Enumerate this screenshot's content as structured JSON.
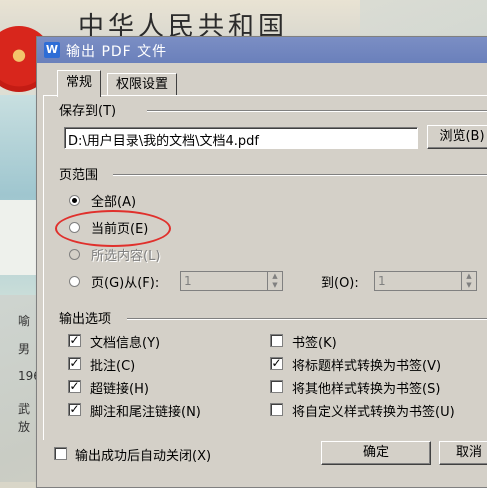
{
  "background": {
    "card_title": "中华人民共和国",
    "rows": [
      "喻",
      "男",
      "196",
      "武",
      "放"
    ]
  },
  "dialog": {
    "app_icon": "W",
    "title": "输出 PDF 文件",
    "tabs": [
      {
        "label": "常规",
        "active": true
      },
      {
        "label": "权限设置",
        "active": false
      }
    ],
    "save": {
      "group_label": "保存到(T)",
      "path_value": "D:\\用户目录\\我的文档\\文档4.pdf",
      "browse_label": "浏览(B)"
    },
    "page_range": {
      "group_label": "页范围",
      "options": [
        {
          "label": "全部(A)",
          "selected": true,
          "enabled": true
        },
        {
          "label": "当前页(E)",
          "selected": false,
          "enabled": true
        },
        {
          "label": "所选内容(L)",
          "selected": false,
          "enabled": false
        },
        {
          "label": "页(G)从(F):",
          "selected": false,
          "enabled": true
        }
      ],
      "from_value": "1",
      "to_label": "到(O):",
      "to_value": "1"
    },
    "output_options": {
      "group_label": "输出选项",
      "left": [
        {
          "label": "文档信息(Y)",
          "checked": true
        },
        {
          "label": "批注(C)",
          "checked": true
        },
        {
          "label": "超链接(H)",
          "checked": true
        },
        {
          "label": "脚注和尾注链接(N)",
          "checked": true
        }
      ],
      "right": [
        {
          "label": "书签(K)",
          "checked": false
        },
        {
          "label": "将标题样式转换为书签(V)",
          "checked": true
        },
        {
          "label": "将其他样式转换为书签(S)",
          "checked": false
        },
        {
          "label": "将自定义样式转换为书签(U)",
          "checked": false
        }
      ]
    },
    "footer": {
      "auto_close_label": "输出成功后自动关闭(X)",
      "auto_close_checked": false,
      "ok_label": "确定",
      "cancel_label": "取消"
    }
  },
  "colors": {
    "titlebar": "#6a80bb",
    "highlight_ring": "#e0302c",
    "dialog_bg": "#d4d0c8"
  }
}
